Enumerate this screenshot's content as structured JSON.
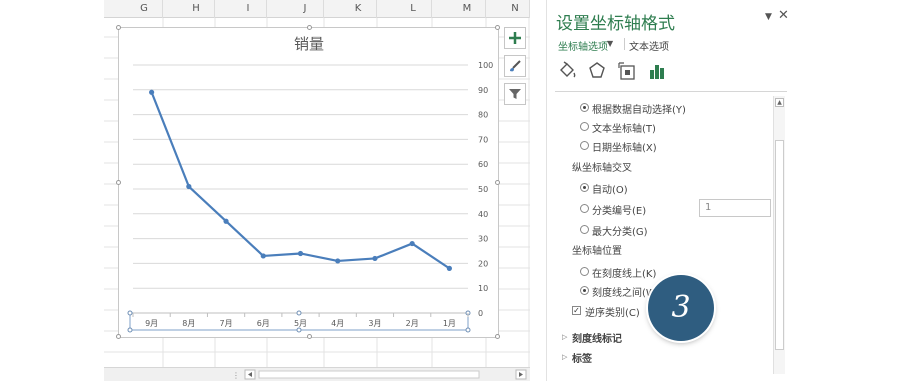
{
  "sheet": {
    "columns": [
      "G",
      "H",
      "I",
      "J",
      "K",
      "L",
      "M",
      "N"
    ]
  },
  "chart": {
    "buttons": [
      {
        "name": "chart-elements-button",
        "icon": "plus-icon"
      },
      {
        "name": "chart-styles-button",
        "icon": "brush-icon"
      },
      {
        "name": "chart-filters-button",
        "icon": "filter-icon"
      }
    ]
  },
  "chart_data": {
    "type": "line",
    "title": "销量",
    "categories": [
      "9月",
      "8月",
      "7月",
      "6月",
      "5月",
      "4月",
      "3月",
      "2月",
      "1月"
    ],
    "series": [
      {
        "values": [
          89,
          51,
          37,
          23,
          24,
          21,
          22,
          28,
          18
        ],
        "color": "#4a7ebb"
      }
    ],
    "y_ticks": [
      "100",
      "90",
      "80",
      "70",
      "60",
      "50",
      "40",
      "30",
      "20",
      "10",
      "0"
    ],
    "ylim": [
      0,
      100
    ],
    "y_axis_side": "right",
    "x_reversed": true,
    "grid": true
  },
  "pane": {
    "title": "设置坐标轴格式",
    "dropdown_icon": "▼",
    "close_icon": "✕",
    "tab_axis": "坐标轴选项",
    "tab_axis_caret": "▼",
    "tab_text": "文本选项",
    "icons": [
      "fill-bucket-icon",
      "pentagon-icon",
      "size-properties-icon",
      "axis-options-icon"
    ],
    "axis_type": {
      "options": [
        {
          "label": "根据数据自动选择(Y)",
          "selected": true
        },
        {
          "label": "文本坐标轴(T)",
          "selected": false
        },
        {
          "label": "日期坐标轴(X)",
          "selected": false
        }
      ]
    },
    "cross": {
      "title": "纵坐标轴交叉",
      "options": [
        {
          "label": "自动(O)",
          "selected": true
        },
        {
          "label": "分类编号(E)",
          "selected": false
        },
        {
          "label": "最大分类(G)",
          "selected": false
        }
      ],
      "category_value": "1"
    },
    "position": {
      "title": "坐标轴位置",
      "options": [
        {
          "label": "在刻度线上(K)",
          "selected": false
        },
        {
          "label": "刻度线之间(W)",
          "selected": true
        }
      ]
    },
    "reverse": {
      "label": "逆序类别(C)",
      "checked": true
    },
    "sections": [
      "刻度线标记",
      "标签"
    ]
  },
  "badge": {
    "text": "3"
  }
}
